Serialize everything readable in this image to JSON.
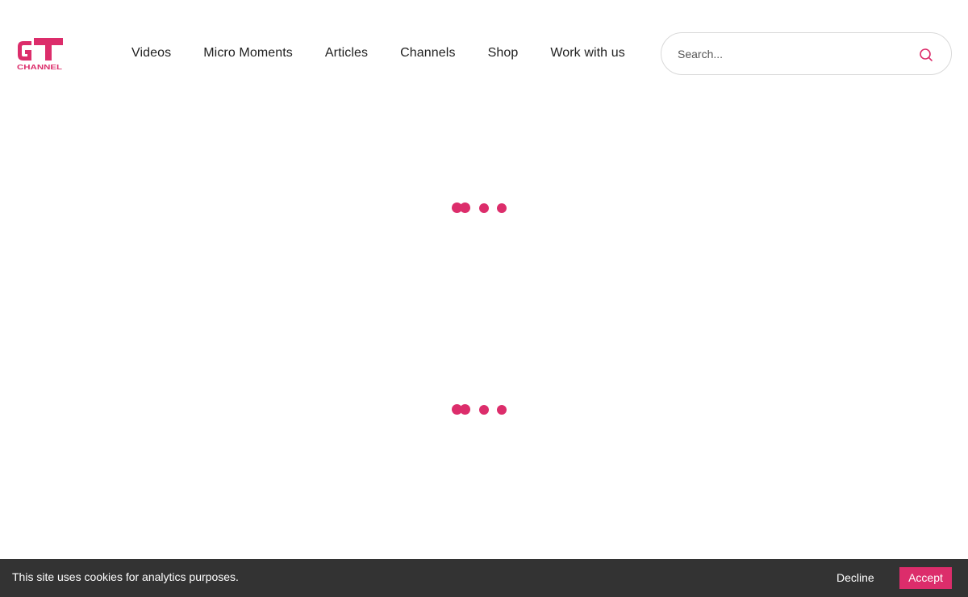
{
  "colors": {
    "accent": "#dc2d6b",
    "cookie_bar_bg": "#333333",
    "text": "#1f1f1f"
  },
  "header": {
    "logo": {
      "icon": "gt-channel-logo",
      "main_text": "GT",
      "sub_text": "CHANNEL"
    },
    "nav": [
      {
        "label": "Videos"
      },
      {
        "label": "Micro Moments"
      },
      {
        "label": "Articles"
      },
      {
        "label": "Channels"
      },
      {
        "label": "Shop"
      },
      {
        "label": "Work with us"
      }
    ],
    "search": {
      "placeholder": "Search...",
      "value": "",
      "icon": "search-icon"
    }
  },
  "main": {
    "loaders": [
      {
        "icon": "loading-dots-icon"
      },
      {
        "icon": "loading-dots-icon"
      }
    ]
  },
  "cookie_banner": {
    "message": "This site uses cookies for analytics purposes.",
    "decline_label": "Decline",
    "accept_label": "Accept"
  }
}
